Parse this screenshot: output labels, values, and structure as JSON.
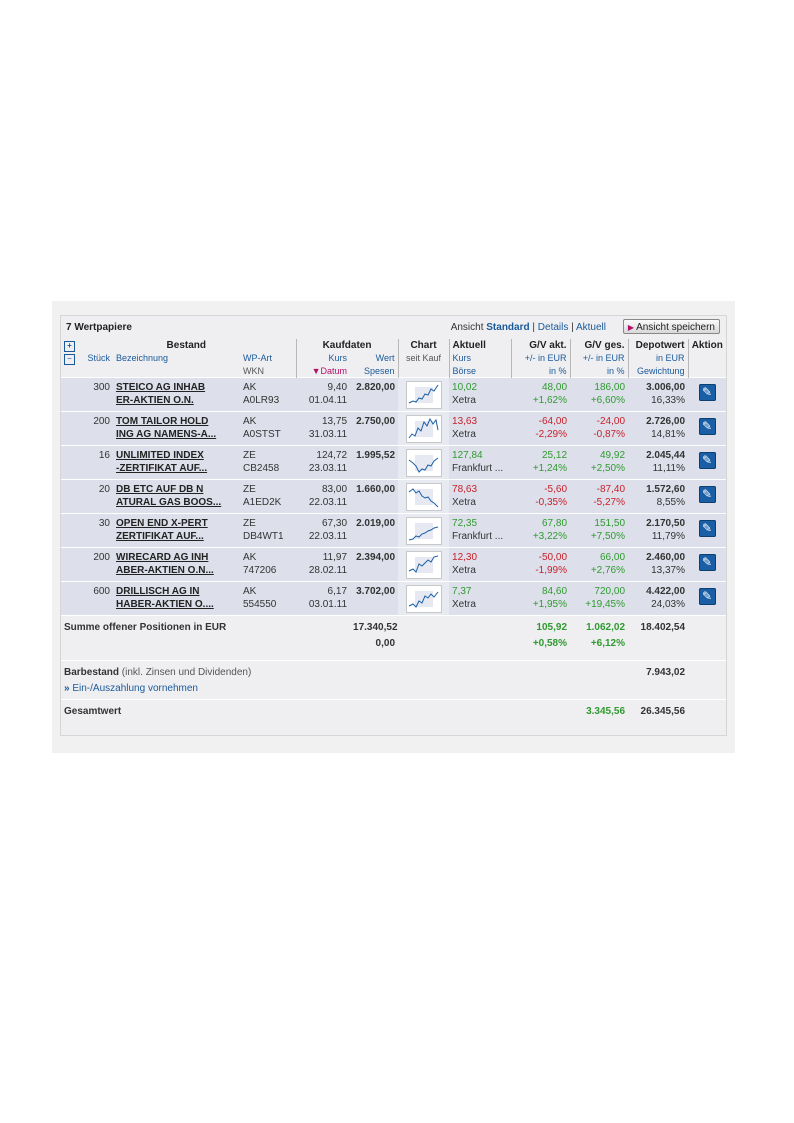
{
  "header": {
    "count": "7 Wertpapiere",
    "ansicht_label": "Ansicht",
    "views": [
      "Standard",
      "Details",
      "Aktuell"
    ],
    "save_button": "Ansicht speichern"
  },
  "columns": {
    "bestand": "Bestand",
    "stueck": "Stück",
    "bezeichnung": "Bezeichnung",
    "wpart": "WP-Art",
    "wkn": "WKN",
    "kaufdaten": "Kaufdaten",
    "kurs": "Kurs",
    "wert": "Wert",
    "datum": "Datum",
    "spesen": "Spesen",
    "chart": "Chart",
    "seit_kauf": "seit Kauf",
    "aktuell": "Aktuell",
    "akt_kurs": "Kurs",
    "boerse": "Börse",
    "gv_akt": "G/V akt.",
    "gv_ges": "G/V ges.",
    "in_eur": "+/- in EUR",
    "in_pct": "in %",
    "depotwert": "Depotwert",
    "depot_eur": "in EUR",
    "gewichtung": "Gewichtung",
    "aktion": "Aktion"
  },
  "positions": [
    {
      "stueck": "300",
      "name1": "STEICO AG INHAB",
      "name2": "ER-AKTIEN O.N.",
      "art": "AK",
      "wkn": "A0LR93",
      "kurs": "9,40",
      "datum": "01.04.11",
      "wert": "2.820,00",
      "akt_kurs": "10,02",
      "boerse": "Xetra",
      "gva_eur": "48,00",
      "gva_pct": "+1,62%",
      "gvg_eur": "186,00",
      "gvg_pct": "+6,60%",
      "depot": "3.006,00",
      "gew": "16,33%",
      "sign_akt": "pos",
      "sign_ges": "pos",
      "kurs_sign": "pos"
    },
    {
      "stueck": "200",
      "name1": "TOM TAILOR HOLD",
      "name2": "ING AG NAMENS-A...",
      "art": "AK",
      "wkn": "A0STST",
      "kurs": "13,75",
      "datum": "31.03.11",
      "wert": "2.750,00",
      "akt_kurs": "13,63",
      "boerse": "Xetra",
      "gva_eur": "-64,00",
      "gva_pct": "-2,29%",
      "gvg_eur": "-24,00",
      "gvg_pct": "-0,87%",
      "depot": "2.726,00",
      "gew": "14,81%",
      "sign_akt": "neg",
      "sign_ges": "neg",
      "kurs_sign": "neg"
    },
    {
      "stueck": "16",
      "name1": "UNLIMITED INDEX",
      "name2": "-ZERTIFIKAT AUF...",
      "art": "ZE",
      "wkn": "CB2458",
      "kurs": "124,72",
      "datum": "23.03.11",
      "wert": "1.995,52",
      "akt_kurs": "127,84",
      "boerse": "Frankfurt ...",
      "gva_eur": "25,12",
      "gva_pct": "+1,24%",
      "gvg_eur": "49,92",
      "gvg_pct": "+2,50%",
      "depot": "2.045,44",
      "gew": "11,11%",
      "sign_akt": "pos",
      "sign_ges": "pos",
      "kurs_sign": "pos"
    },
    {
      "stueck": "20",
      "name1": "DB ETC AUF DB N",
      "name2": "ATURAL GAS BOOS...",
      "art": "ZE",
      "wkn": "A1ED2K",
      "kurs": "83,00",
      "datum": "22.03.11",
      "wert": "1.660,00",
      "akt_kurs": "78,63",
      "boerse": "Xetra",
      "gva_eur": "-5,60",
      "gva_pct": "-0,35%",
      "gvg_eur": "-87,40",
      "gvg_pct": "-5,27%",
      "depot": "1.572,60",
      "gew": "8,55%",
      "sign_akt": "neg",
      "sign_ges": "neg",
      "kurs_sign": "neg"
    },
    {
      "stueck": "30",
      "name1": "OPEN END X-PERT",
      "name2": "ZERTIFIKAT AUF...",
      "art": "ZE",
      "wkn": "DB4WT1",
      "kurs": "67,30",
      "datum": "22.03.11",
      "wert": "2.019,00",
      "akt_kurs": "72,35",
      "boerse": "Frankfurt ...",
      "gva_eur": "67,80",
      "gva_pct": "+3,22%",
      "gvg_eur": "151,50",
      "gvg_pct": "+7,50%",
      "depot": "2.170,50",
      "gew": "11,79%",
      "sign_akt": "pos",
      "sign_ges": "pos",
      "kurs_sign": "pos"
    },
    {
      "stueck": "200",
      "name1": "WIRECARD AG INH",
      "name2": "ABER-AKTIEN O.N...",
      "art": "AK",
      "wkn": "747206",
      "kurs": "11,97",
      "datum": "28.02.11",
      "wert": "2.394,00",
      "akt_kurs": "12,30",
      "boerse": "Xetra",
      "gva_eur": "-50,00",
      "gva_pct": "-1,99%",
      "gvg_eur": "66,00",
      "gvg_pct": "+2,76%",
      "depot": "2.460,00",
      "gew": "13,37%",
      "sign_akt": "neg",
      "sign_ges": "pos",
      "kurs_sign": "neg"
    },
    {
      "stueck": "600",
      "name1": "DRILLISCH AG IN",
      "name2": "HABER-AKTIEN O....",
      "art": "AK",
      "wkn": "554550",
      "kurs": "6,17",
      "datum": "03.01.11",
      "wert": "3.702,00",
      "akt_kurs": "7,37",
      "boerse": "Xetra",
      "gva_eur": "84,60",
      "gva_pct": "+1,95%",
      "gvg_eur": "720,00",
      "gvg_pct": "+19,45%",
      "depot": "4.422,00",
      "gew": "24,03%",
      "sign_akt": "pos",
      "sign_ges": "pos",
      "kurs_sign": "pos"
    }
  ],
  "summary": {
    "label": "Summe offener Positionen in EUR",
    "wert": "17.340,52",
    "spesen": "0,00",
    "gva_eur": "105,92",
    "gva_pct": "+0,58%",
    "gvg_eur": "1.062,02",
    "gvg_pct": "+6,12%",
    "depot": "18.402,54"
  },
  "cash": {
    "label": "Barbestand",
    "note": "(inkl. Zinsen und Dividenden)",
    "link": "Ein-/Auszahlung vornehmen",
    "value": "7.943,02"
  },
  "total": {
    "label": "Gesamtwert",
    "gv": "3.345,56",
    "value": "26.345,56"
  },
  "colors": {
    "positive": "#2f9a2f",
    "negative": "#c8202a",
    "link": "#1a5a9a",
    "action_button": "#1a5fa6"
  }
}
